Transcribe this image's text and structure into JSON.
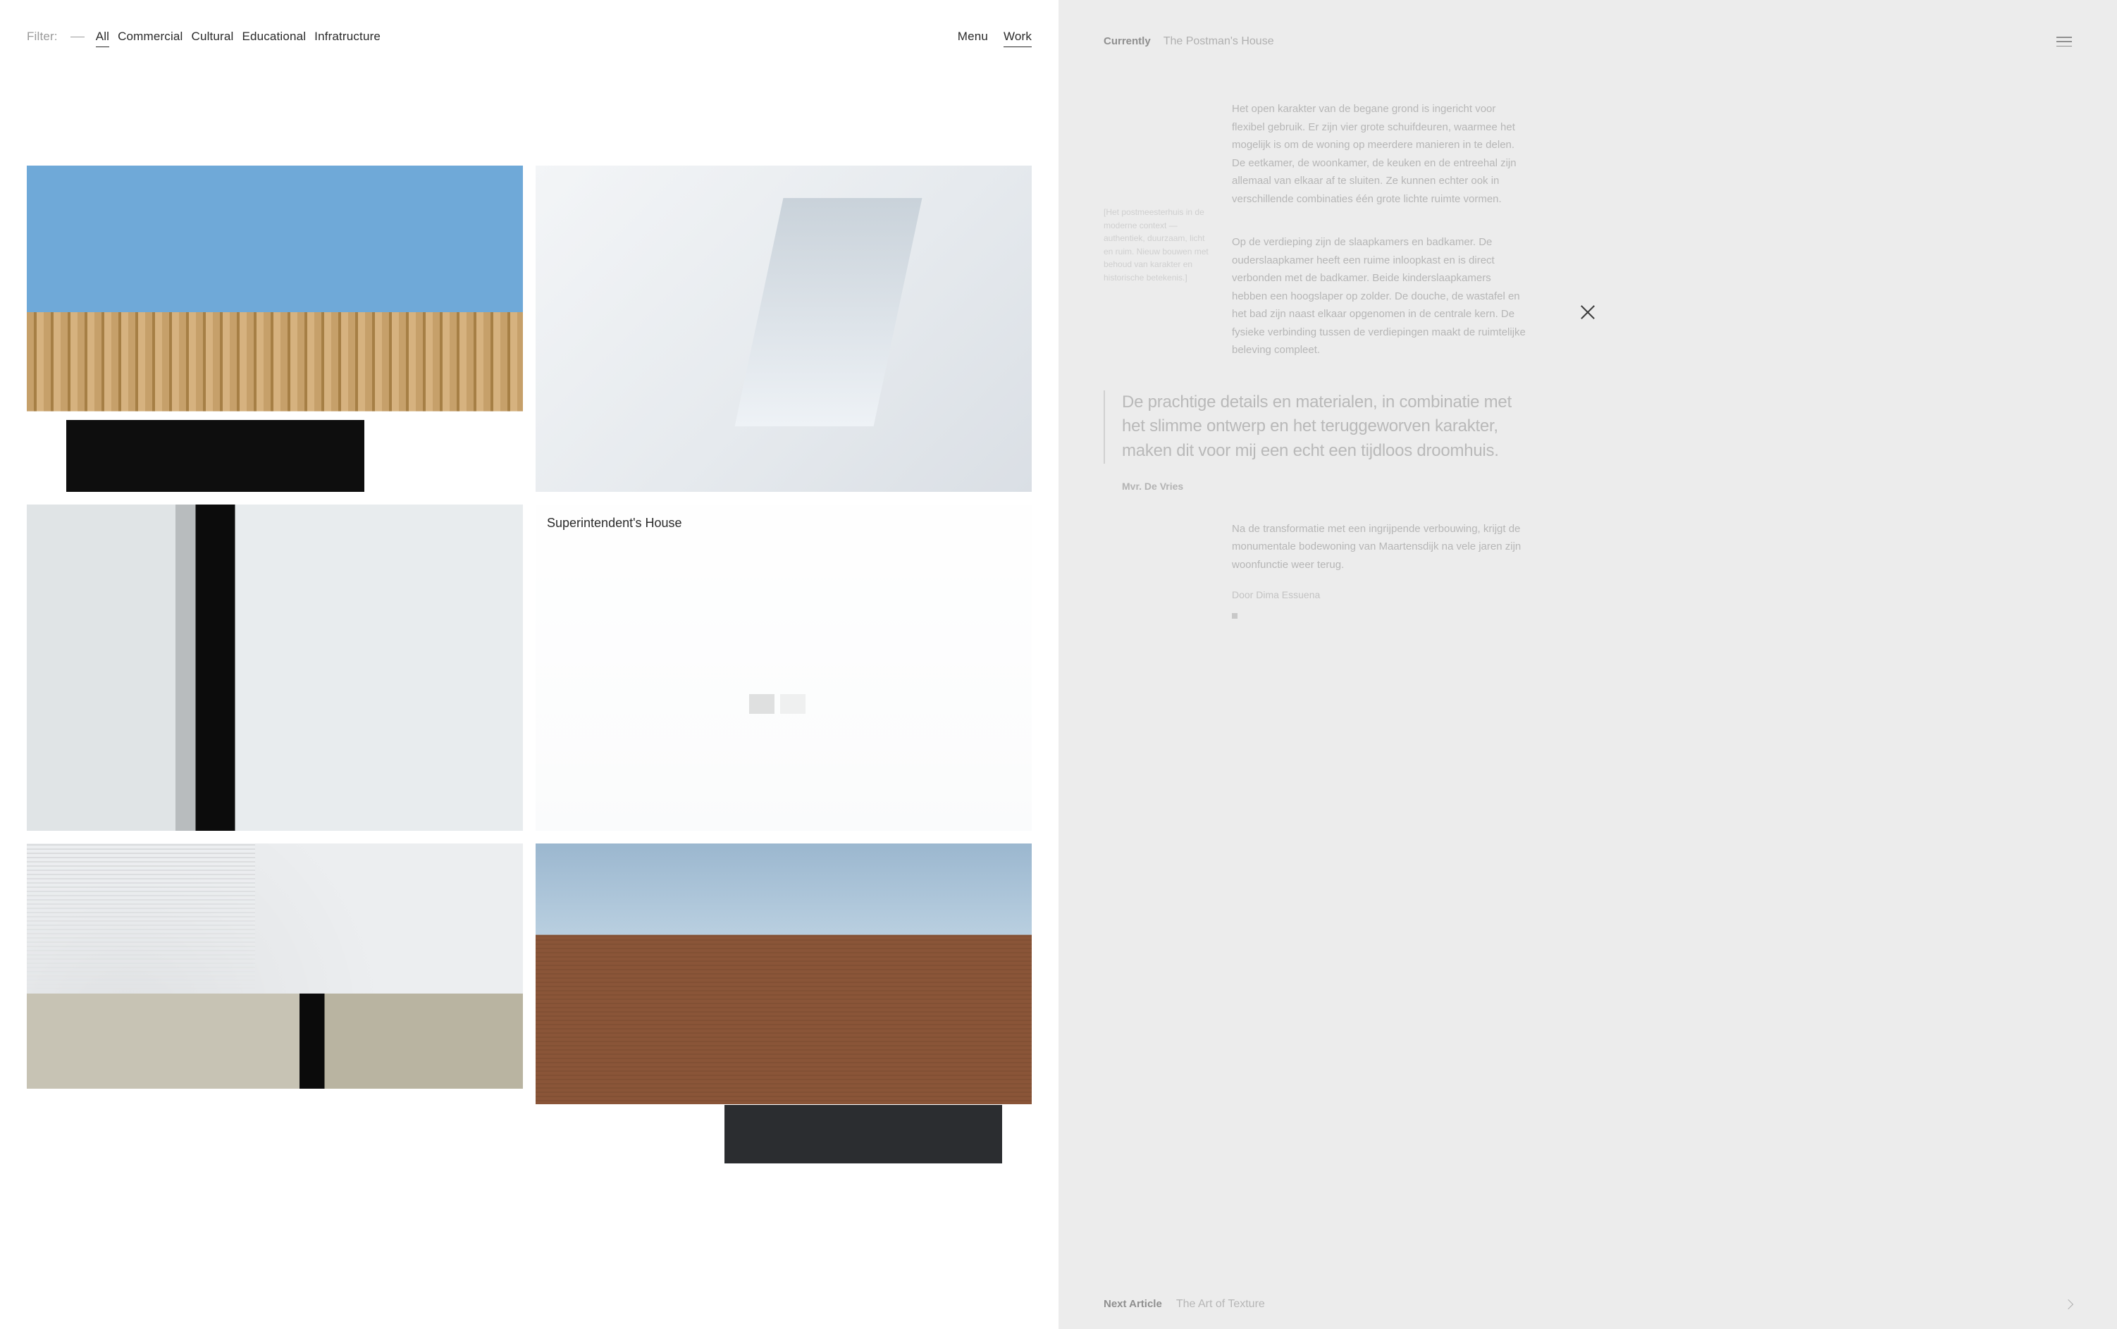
{
  "left": {
    "filter_label": "Filter:",
    "tabs": [
      "All",
      "Commercial",
      "Cultural",
      "Educational",
      "Infratructure"
    ],
    "active_tab": "All",
    "nav": {
      "menu": "Menu",
      "work": "Work"
    },
    "cards": [
      {
        "kind": "img-wood"
      },
      {
        "kind": "img-skylight"
      },
      {
        "kind": "img-glasswall"
      },
      {
        "kind": "img-soft",
        "caption": "Superintendent's House"
      },
      {
        "kind": "img-ceiling"
      },
      {
        "kind": "img-brick"
      }
    ]
  },
  "right": {
    "currently_label": "Currently",
    "article_title": "The Postman's House",
    "side_blurb": "[Het postmeesterhuis in de moderne context — authentiek, duurzaam, licht en ruim. Nieuw bouwen met behoud van karakter en historische betekenis.]",
    "para1": "Het open karakter van de begane grond is ingericht voor flexibel gebruik. Er zijn vier grote schuifdeuren, waarmee het mogelijk is om de woning op meerdere manieren in te delen. De eetkamer, de woonkamer, de keuken en de entreehal zijn allemaal van elkaar af te sluiten. Ze kunnen echter ook in verschillende combinaties één grote lichte ruimte vormen.",
    "para2": "Op de verdieping zijn de slaapkamers en badkamer. De ouderslaapkamer heeft een ruime inloopkast en is direct verbonden met de badkamer. Beide kinderslaapkamers hebben een hoogslaper op zolder. De douche, de wastafel en het bad zijn naast elkaar opgenomen in de centrale kern. De fysieke verbinding tussen de verdiepingen maakt de ruimtelijke beleving compleet.",
    "pullquote": "De prachtige details en materialen, in combinatie met het slimme ontwerp en het teruggeworven karakter, maken dit voor mij een echt een tijdloos droomhuis.",
    "pullquote_attr": "Mvr. De Vries",
    "para3": "Na de transformatie met een ingrijpende verbouwing, krijgt de monumentale bodewoning van Maartensdijk na vele jaren zijn woonfunctie weer terug.",
    "byline": "Door Dima Essuena",
    "next_label": "Next Article",
    "next_title": "The Art of Texture"
  }
}
